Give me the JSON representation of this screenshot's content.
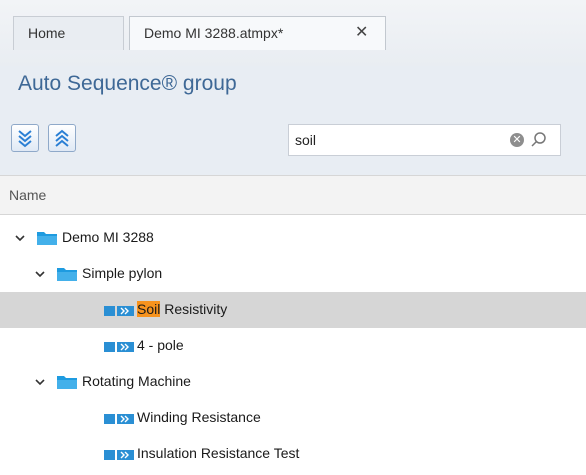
{
  "tabs": [
    {
      "label": "Home"
    },
    {
      "label": "Demo MI 3288.atmpx*",
      "close": "✕"
    }
  ],
  "panel": {
    "title": "Auto Sequence® group"
  },
  "toolbar": {
    "expand_icon": "expand-all-icon",
    "collapse_icon": "collapse-all-icon"
  },
  "search": {
    "value": "soil",
    "clear_icon": "clear-icon",
    "search_icon": "search-icon"
  },
  "grid": {
    "column": "Name",
    "rows": [
      {
        "label": "Demo MI 3288",
        "type": "folder",
        "expanded": true
      },
      {
        "label": "Simple pylon",
        "type": "folder",
        "expanded": true
      },
      {
        "match": "Soil",
        "rest": " Resistivity",
        "type": "sequence",
        "selected": true
      },
      {
        "label": "4 - pole",
        "type": "sequence"
      },
      {
        "label": "Rotating Machine",
        "type": "folder",
        "expanded": true
      },
      {
        "label": "Winding Resistance",
        "type": "sequence"
      },
      {
        "label": "Insulation Resistance Test",
        "type": "sequence"
      }
    ]
  },
  "colors": {
    "accent": "#3e6896",
    "folder": "#1e9be0",
    "highlight": "#f7931e",
    "selection": "#d6d6d6"
  }
}
